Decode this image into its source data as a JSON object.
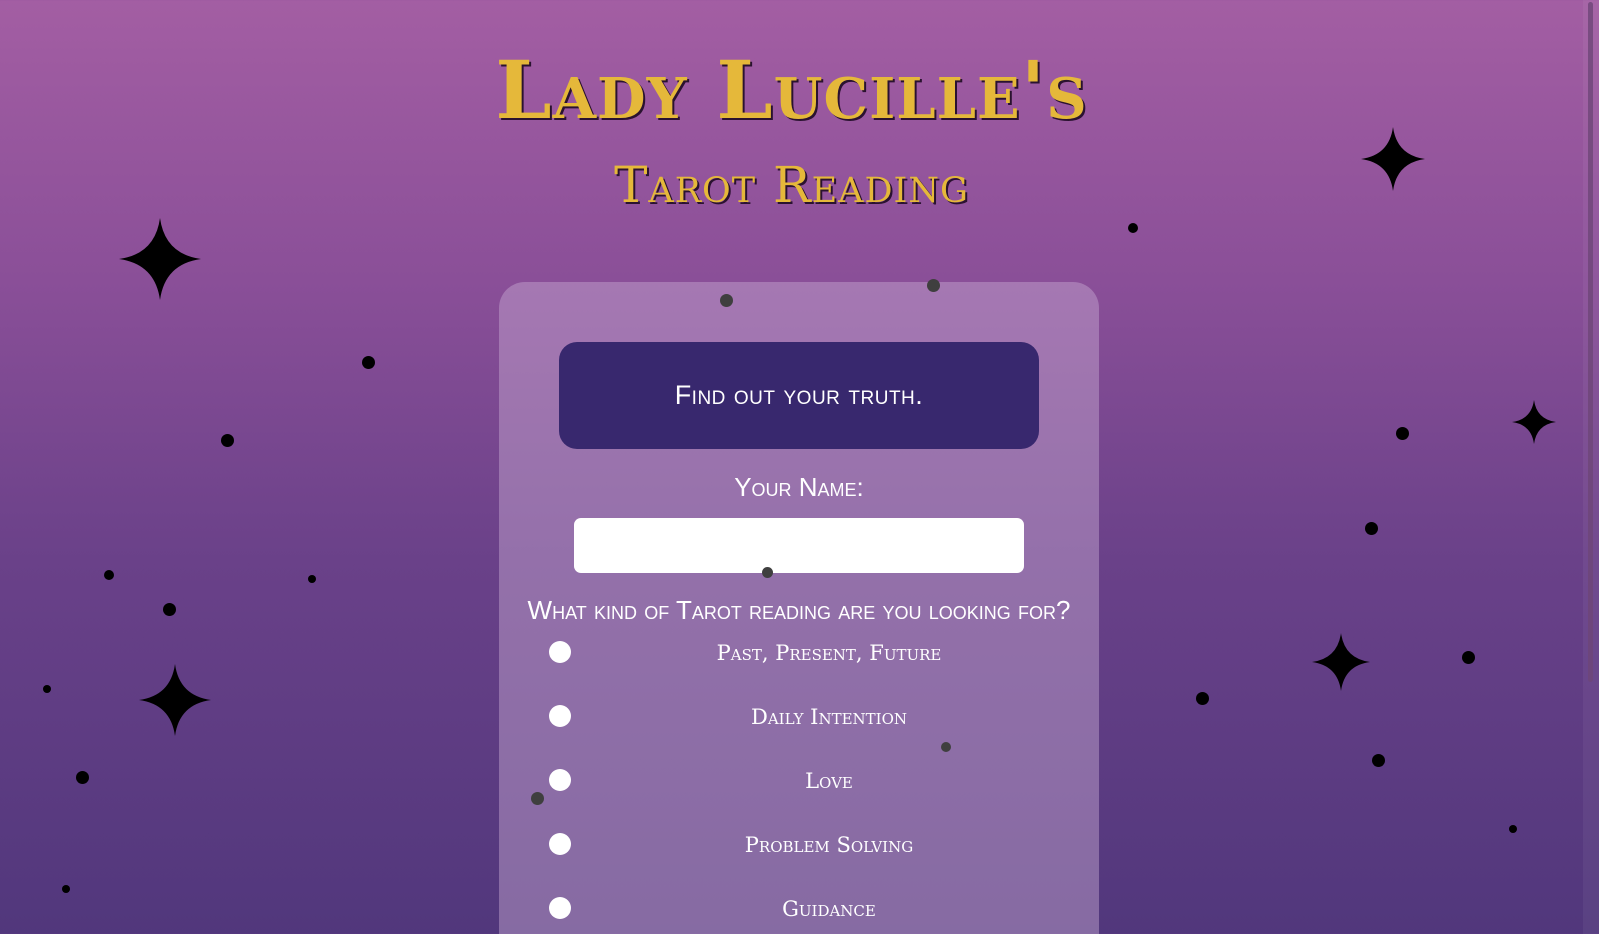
{
  "header": {
    "title": "Lady Lucille's",
    "subtitle": "Tarot Reading"
  },
  "card": {
    "banner": "Find out your truth.",
    "name_label": "Your Name:",
    "name_value": "",
    "question": "What kind of Tarot reading are you looking for?",
    "options": [
      {
        "label": "Past, Present, Future"
      },
      {
        "label": "Daily Intention"
      },
      {
        "label": "Love"
      },
      {
        "label": "Problem Solving"
      },
      {
        "label": "Guidance"
      }
    ]
  },
  "colors": {
    "title_gold": "#e5b83a",
    "banner_bg": "#38286e",
    "bg_top": "#a35ea3",
    "bg_bottom": "#51377c"
  }
}
